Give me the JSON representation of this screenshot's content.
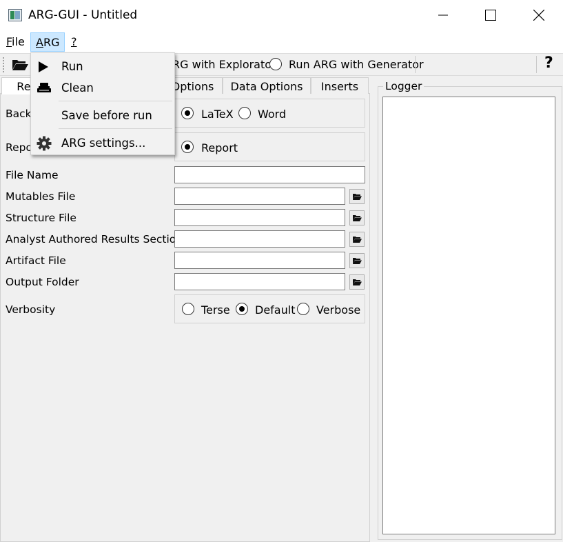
{
  "window": {
    "title": "ARG-GUI - Untitled",
    "controls": {
      "minimize": "—",
      "maximize": "☐",
      "close": "✕"
    }
  },
  "menubar": {
    "items": [
      {
        "label": "File",
        "mnemonic": "F",
        "rest": "ile"
      },
      {
        "label": "ARG",
        "mnemonic": "A",
        "rest": "RG"
      },
      {
        "label": "?",
        "mnemonic": "?",
        "rest": ""
      }
    ]
  },
  "toolbar": {
    "open_icon": "folder-open-icon",
    "explorator_label": "RG with Explorator",
    "generator_label": "Run ARG with Generator",
    "help_label": "?"
  },
  "tabs": [
    {
      "label": "Rep",
      "selected": true
    },
    {
      "label": "Options",
      "selected": false
    },
    {
      "label": "Data Options",
      "selected": false
    },
    {
      "label": "Inserts",
      "selected": false
    }
  ],
  "form": {
    "backend_label": "Back",
    "backend_options": [
      {
        "label": "LaTeX",
        "checked": true
      },
      {
        "label": "Word",
        "checked": false
      }
    ],
    "report_label": "Repo",
    "report_options": [
      {
        "label": "Report",
        "checked": true
      }
    ],
    "file_name": {
      "label": "File Name",
      "value": ""
    },
    "mutables_file": {
      "label": "Mutables File",
      "value": ""
    },
    "structure_file": {
      "label": "Structure File",
      "value": ""
    },
    "analyst_results": {
      "label": "Analyst Authored Results Section",
      "value": ""
    },
    "artifact_file": {
      "label": "Artifact File",
      "value": ""
    },
    "output_folder": {
      "label": "Output Folder",
      "value": ""
    },
    "verbosity": {
      "label": "Verbosity",
      "options": [
        {
          "label": "Terse",
          "checked": false
        },
        {
          "label": "Default",
          "checked": true
        },
        {
          "label": "Verbose",
          "checked": false
        }
      ]
    }
  },
  "logger": {
    "title": "Logger",
    "content": ""
  },
  "arg_menu": {
    "items": [
      {
        "label": "Run",
        "icon": "play-icon"
      },
      {
        "label": "Clean",
        "icon": "broom-icon"
      },
      {
        "label": "Save before run",
        "icon": ""
      },
      {
        "label": "ARG settings...",
        "icon": "gear-icon"
      }
    ]
  },
  "colors": {
    "menu_highlight": "#cce8ff",
    "window_bg": "#f0f0f0",
    "field_bg": "#ffffff"
  }
}
